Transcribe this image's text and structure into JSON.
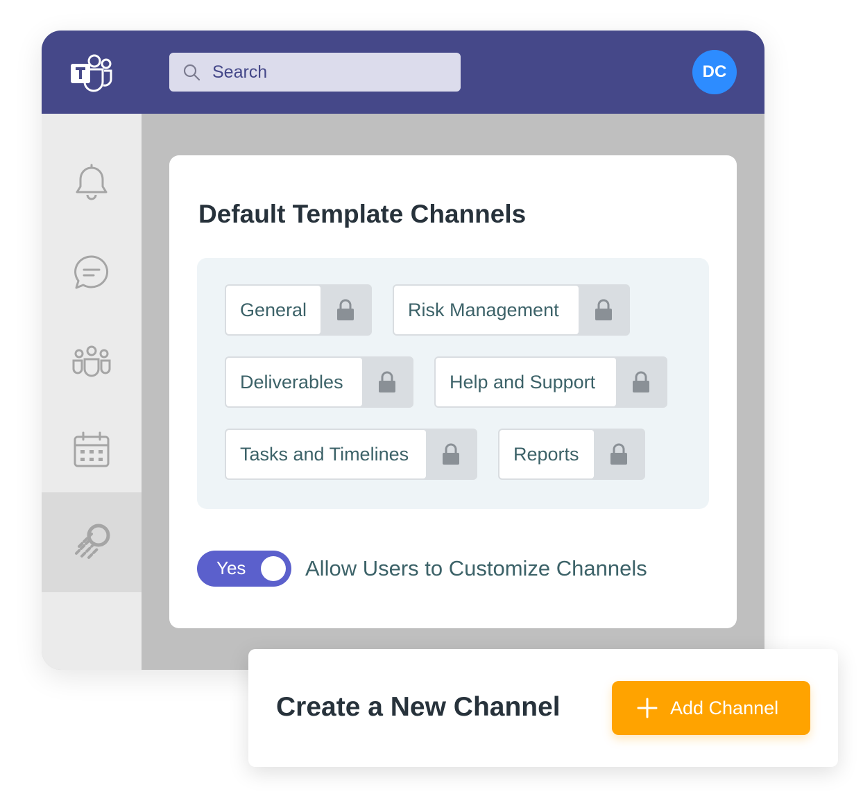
{
  "header": {
    "logo_icon": "microsoft-teams-logo",
    "search": {
      "placeholder": "Search"
    },
    "avatar": {
      "initials": "DC",
      "color": "#2d8cff"
    },
    "color": "#454889"
  },
  "sidebar": {
    "items": [
      {
        "icon": "bell-icon",
        "active": false
      },
      {
        "icon": "chat-icon",
        "active": false
      },
      {
        "icon": "teams-icon",
        "active": false
      },
      {
        "icon": "calendar-icon",
        "active": false
      },
      {
        "icon": "app-logo-icon",
        "active": true
      }
    ]
  },
  "panel": {
    "title": "Default Template Channels",
    "channels": [
      {
        "label": "General",
        "locked": true
      },
      {
        "label": "Risk Management",
        "locked": true
      },
      {
        "label": "Deliverables",
        "locked": true
      },
      {
        "label": "Help and Support",
        "locked": true
      },
      {
        "label": "Tasks and Timelines",
        "locked": true
      },
      {
        "label": "Reports",
        "locked": true
      }
    ],
    "toggle": {
      "label": "Yes",
      "on": true,
      "caption": "Allow Users to Customize Channels",
      "color": "#5b60cc"
    }
  },
  "new_channel": {
    "title": "Create a New Channel",
    "button_label": "Add Channel",
    "button_color": "#ffa300"
  }
}
